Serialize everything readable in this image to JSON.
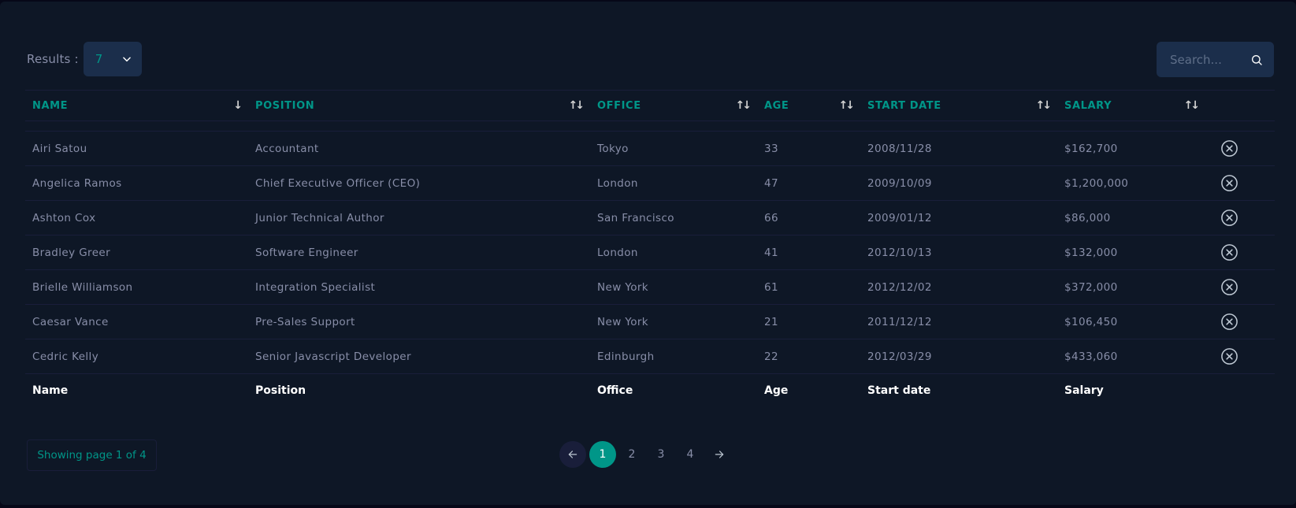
{
  "results": {
    "label": "Results :",
    "selected": "7"
  },
  "search": {
    "placeholder": "Search..."
  },
  "columns": [
    "NAME",
    "POSITION",
    "OFFICE",
    "AGE",
    "START DATE",
    "SALARY"
  ],
  "footer": [
    "Name",
    "Position",
    "Office",
    "Age",
    "Start date",
    "Salary"
  ],
  "rows": [
    [
      "Airi Satou",
      "Accountant",
      "Tokyo",
      "33",
      "2008/11/28",
      "$162,700"
    ],
    [
      "Angelica Ramos",
      "Chief Executive Officer (CEO)",
      "London",
      "47",
      "2009/10/09",
      "$1,200,000"
    ],
    [
      "Ashton Cox",
      "Junior Technical Author",
      "San Francisco",
      "66",
      "2009/01/12",
      "$86,000"
    ],
    [
      "Bradley Greer",
      "Software Engineer",
      "London",
      "41",
      "2012/10/13",
      "$132,000"
    ],
    [
      "Brielle Williamson",
      "Integration Specialist",
      "New York",
      "61",
      "2012/12/02",
      "$372,000"
    ],
    [
      "Caesar Vance",
      "Pre-Sales Support",
      "New York",
      "21",
      "2011/12/12",
      "$106,450"
    ],
    [
      "Cedric Kelly",
      "Senior Javascript Developer",
      "Edinburgh",
      "22",
      "2012/03/29",
      "$433,060"
    ]
  ],
  "sort": {
    "active": "↓",
    "inactive": "↑↓"
  },
  "pagination": {
    "info": "Showing page 1 of 4",
    "pages": [
      "1",
      "2",
      "3",
      "4"
    ],
    "current": "1"
  },
  "colors": {
    "accent": "#009688",
    "panel": "#0e1726",
    "control": "#1b2e4b",
    "text": "#888ea8"
  },
  "icons": {
    "dropdown": "chevron-down-icon",
    "search": "search-icon",
    "remove": "x-circle-icon",
    "prev": "arrow-left-icon",
    "next": "arrow-right-icon"
  }
}
